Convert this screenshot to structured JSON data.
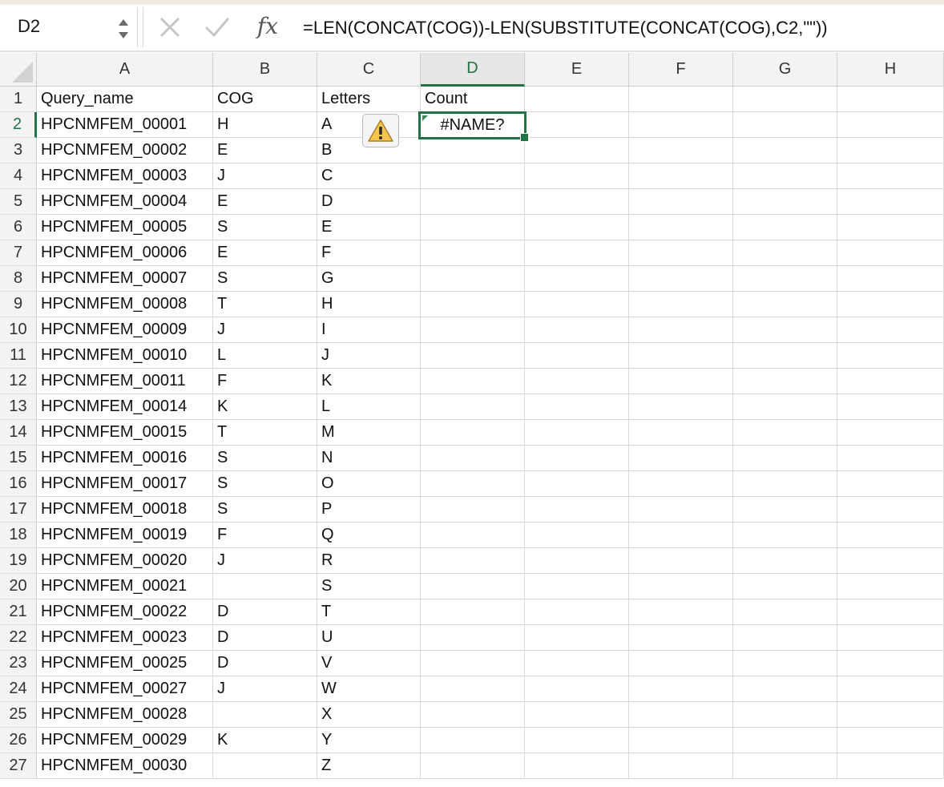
{
  "formula_bar": {
    "name_box": "D2",
    "formula": "=LEN(CONCAT(COG))-LEN(SUBSTITUTE(CONCAT(COG),C2,\"\"))",
    "fx_label": "fx",
    "cancel_icon": "close-icon",
    "enter_icon": "checkmark-icon"
  },
  "columns": [
    "A",
    "B",
    "C",
    "D",
    "E",
    "F",
    "G",
    "H"
  ],
  "active_column": "D",
  "active_row": "2",
  "rows": [
    {
      "num": "1",
      "a": "Query_name",
      "b": "COG",
      "c": "Letters",
      "d": "Count"
    },
    {
      "num": "2",
      "a": "HPCNMFEM_00001",
      "b": "H",
      "c": "A",
      "d": ""
    },
    {
      "num": "3",
      "a": "HPCNMFEM_00002",
      "b": "E",
      "c": "B",
      "d": ""
    },
    {
      "num": "4",
      "a": "HPCNMFEM_00003",
      "b": "J",
      "c": "C",
      "d": ""
    },
    {
      "num": "5",
      "a": "HPCNMFEM_00004",
      "b": "E",
      "c": "D",
      "d": ""
    },
    {
      "num": "6",
      "a": "HPCNMFEM_00005",
      "b": "S",
      "c": "E",
      "d": ""
    },
    {
      "num": "7",
      "a": "HPCNMFEM_00006",
      "b": "E",
      "c": "F",
      "d": ""
    },
    {
      "num": "8",
      "a": "HPCNMFEM_00007",
      "b": "S",
      "c": "G",
      "d": ""
    },
    {
      "num": "9",
      "a": "HPCNMFEM_00008",
      "b": "T",
      "c": "H",
      "d": ""
    },
    {
      "num": "10",
      "a": "HPCNMFEM_00009",
      "b": "J",
      "c": "I",
      "d": ""
    },
    {
      "num": "11",
      "a": "HPCNMFEM_00010",
      "b": "L",
      "c": "J",
      "d": ""
    },
    {
      "num": "12",
      "a": "HPCNMFEM_00011",
      "b": "F",
      "c": "K",
      "d": ""
    },
    {
      "num": "13",
      "a": "HPCNMFEM_00014",
      "b": "K",
      "c": "L",
      "d": ""
    },
    {
      "num": "14",
      "a": "HPCNMFEM_00015",
      "b": "T",
      "c": "M",
      "d": ""
    },
    {
      "num": "15",
      "a": "HPCNMFEM_00016",
      "b": "S",
      "c": "N",
      "d": ""
    },
    {
      "num": "16",
      "a": "HPCNMFEM_00017",
      "b": "S",
      "c": "O",
      "d": ""
    },
    {
      "num": "17",
      "a": "HPCNMFEM_00018",
      "b": "S",
      "c": "P",
      "d": ""
    },
    {
      "num": "18",
      "a": "HPCNMFEM_00019",
      "b": "F",
      "c": "Q",
      "d": ""
    },
    {
      "num": "19",
      "a": "HPCNMFEM_00020",
      "b": "J",
      "c": "R",
      "d": ""
    },
    {
      "num": "20",
      "a": "HPCNMFEM_00021",
      "b": "",
      "c": "S",
      "d": ""
    },
    {
      "num": "21",
      "a": "HPCNMFEM_00022",
      "b": "D",
      "c": "T",
      "d": ""
    },
    {
      "num": "22",
      "a": "HPCNMFEM_00023",
      "b": "D",
      "c": "U",
      "d": ""
    },
    {
      "num": "23",
      "a": "HPCNMFEM_00025",
      "b": "D",
      "c": "V",
      "d": ""
    },
    {
      "num": "24",
      "a": "HPCNMFEM_00027",
      "b": "J",
      "c": "W",
      "d": ""
    },
    {
      "num": "25",
      "a": "HPCNMFEM_00028",
      "b": "",
      "c": "X",
      "d": ""
    },
    {
      "num": "26",
      "a": "HPCNMFEM_00029",
      "b": "K",
      "c": "Y",
      "d": ""
    },
    {
      "num": "27",
      "a": "HPCNMFEM_00030",
      "b": "",
      "c": "Z",
      "d": ""
    }
  ],
  "active_cell": {
    "ref": "D2",
    "value": "#NAME?"
  },
  "warning_icon": "warning-icon",
  "colors": {
    "accent": "#217346",
    "warning": "#f5c451",
    "header_bg": "#f3f3f3",
    "gridline": "#d9d9d9"
  }
}
